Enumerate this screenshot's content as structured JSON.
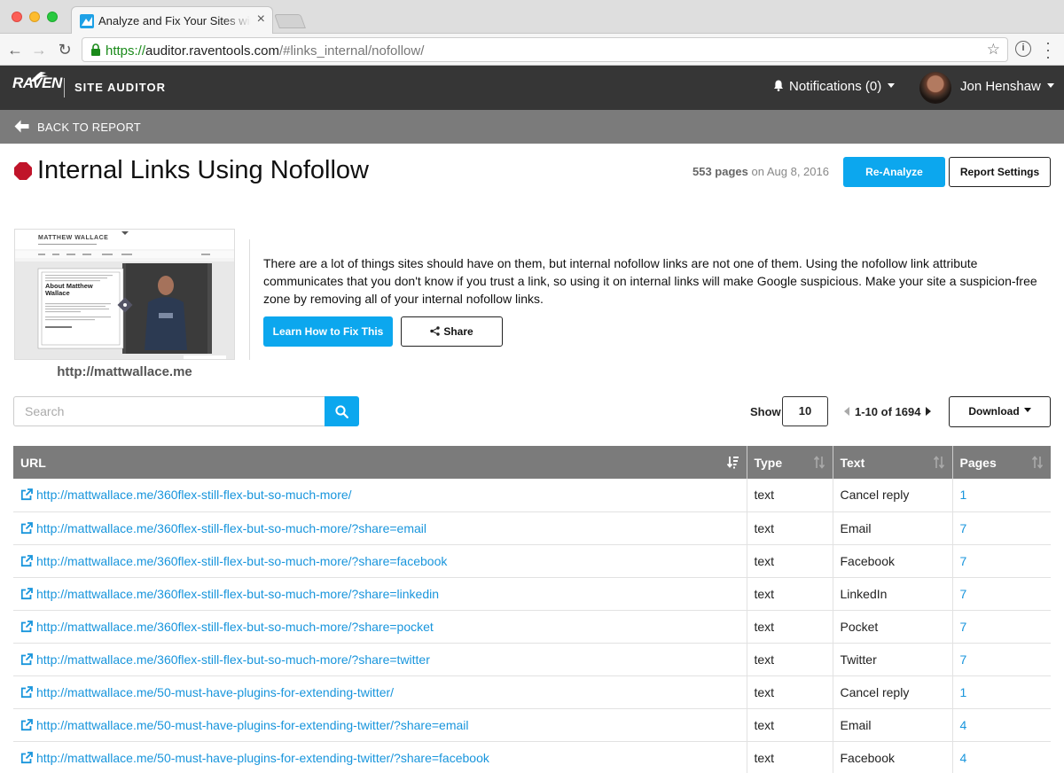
{
  "browser": {
    "tab_title": "Analyze and Fix Your Sites with",
    "url_scheme": "https://",
    "url_host": "auditor.raventools.com",
    "url_path": "/#links_internal/nofollow/"
  },
  "header": {
    "logo": "RAVEN",
    "product": "SITE AUDITOR",
    "notifications": "Notifications (0)",
    "user_name": "Jon Henshaw"
  },
  "backbar": {
    "label": "BACK TO REPORT"
  },
  "report": {
    "title": "Internal Links Using Nofollow",
    "pages_count": "553 pages",
    "date_text": "on Aug 8, 2016",
    "reanalyze_label": "Re-Analyze",
    "settings_label": "Report Settings"
  },
  "site": {
    "caption": "http://mattwallace.me",
    "thumb_brand": "MATTHEW WALLACE",
    "thumb_about": "About Matthew Wallace"
  },
  "description": {
    "text": "There are a lot of things sites should have on them, but internal nofollow links are not one of them. Using the nofollow link attribute communicates that you don't know if you trust a link, so using it on internal links will make Google suspicious. Make your site a suspicion-free zone by removing all of your internal nofollow links.",
    "learn_label": "Learn How to Fix This",
    "share_label": "Share"
  },
  "toolbar": {
    "search_placeholder": "Search",
    "show_label": "Show",
    "show_value": "10",
    "pager_text": "1-10 of 1694",
    "download_label": "Download"
  },
  "table": {
    "headers": {
      "url": "URL",
      "type": "Type",
      "text": "Text",
      "pages": "Pages"
    },
    "rows": [
      {
        "url": "http://mattwallace.me/360flex-still-flex-but-so-much-more/",
        "type": "text",
        "text": "Cancel reply",
        "pages": "1"
      },
      {
        "url": "http://mattwallace.me/360flex-still-flex-but-so-much-more/?share=email",
        "type": "text",
        "text": "Email",
        "pages": "7"
      },
      {
        "url": "http://mattwallace.me/360flex-still-flex-but-so-much-more/?share=facebook",
        "type": "text",
        "text": "Facebook",
        "pages": "7"
      },
      {
        "url": "http://mattwallace.me/360flex-still-flex-but-so-much-more/?share=linkedin",
        "type": "text",
        "text": "LinkedIn",
        "pages": "7"
      },
      {
        "url": "http://mattwallace.me/360flex-still-flex-but-so-much-more/?share=pocket",
        "type": "text",
        "text": "Pocket",
        "pages": "7"
      },
      {
        "url": "http://mattwallace.me/360flex-still-flex-but-so-much-more/?share=twitter",
        "type": "text",
        "text": "Twitter",
        "pages": "7"
      },
      {
        "url": "http://mattwallace.me/50-must-have-plugins-for-extending-twitter/",
        "type": "text",
        "text": "Cancel reply",
        "pages": "1"
      },
      {
        "url": "http://mattwallace.me/50-must-have-plugins-for-extending-twitter/?share=email",
        "type": "text",
        "text": "Email",
        "pages": "4"
      },
      {
        "url": "http://mattwallace.me/50-must-have-plugins-for-extending-twitter/?share=facebook",
        "type": "text",
        "text": "Facebook",
        "pages": "4"
      }
    ]
  },
  "colors": {
    "accent": "#0ca7ee",
    "link": "#1895dc",
    "header_bg": "#363636",
    "subbar_bg": "#7b7b7b",
    "error": "#c0142a"
  }
}
